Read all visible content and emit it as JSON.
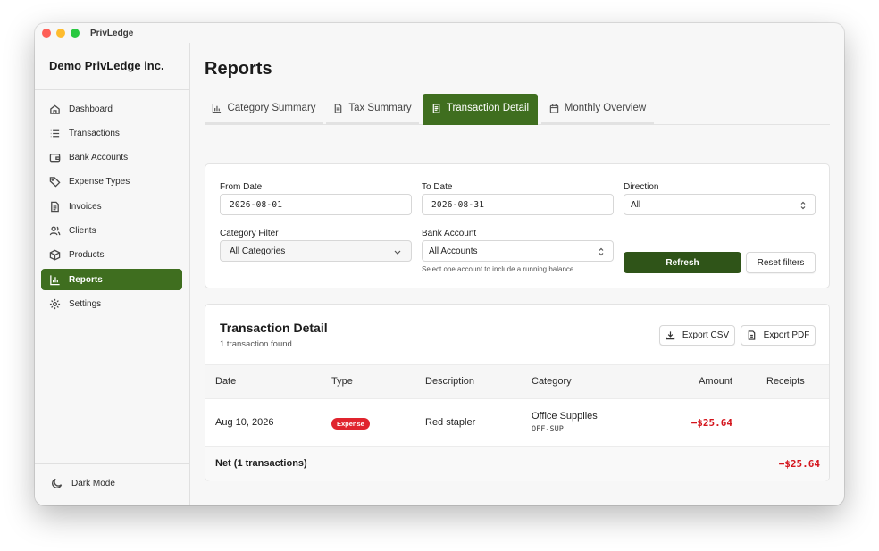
{
  "window": {
    "title": "PrivLedge"
  },
  "sidebar": {
    "company": "Demo PrivLedge inc.",
    "items": [
      {
        "label": "Dashboard",
        "icon": "home-icon"
      },
      {
        "label": "Transactions",
        "icon": "list-icon"
      },
      {
        "label": "Bank Accounts",
        "icon": "wallet-icon"
      },
      {
        "label": "Expense Types",
        "icon": "tag-icon"
      },
      {
        "label": "Invoices",
        "icon": "document-icon"
      },
      {
        "label": "Clients",
        "icon": "users-icon"
      },
      {
        "label": "Products",
        "icon": "box-icon"
      },
      {
        "label": "Reports",
        "icon": "bar-chart-icon",
        "active": true
      },
      {
        "label": "Settings",
        "icon": "gear-icon"
      }
    ],
    "dark_mode_label": "Dark Mode"
  },
  "page": {
    "title": "Reports",
    "tabs": [
      {
        "label": "Category Summary",
        "icon": "bar-chart-icon"
      },
      {
        "label": "Tax Summary",
        "icon": "document-icon"
      },
      {
        "label": "Transaction Detail",
        "icon": "document-icon",
        "active": true
      },
      {
        "label": "Monthly Overview",
        "icon": "calendar-icon"
      }
    ]
  },
  "filters": {
    "from_date_label": "From Date",
    "from_date_value": "2026-08-01",
    "to_date_label": "To Date",
    "to_date_value": "2026-08-31",
    "direction_label": "Direction",
    "direction_value": "All",
    "category_label": "Category Filter",
    "category_value": "All Categories",
    "bank_label": "Bank Account",
    "bank_value": "All Accounts",
    "bank_hint": "Select one account to include a running balance.",
    "refresh_label": "Refresh",
    "reset_label": "Reset filters"
  },
  "detail": {
    "title": "Transaction Detail",
    "subtitle": "1 transaction found",
    "export_csv_label": "Export CSV",
    "export_pdf_label": "Export PDF",
    "columns": [
      "Date",
      "Type",
      "Description",
      "Category",
      "Amount",
      "Receipts"
    ],
    "rows": [
      {
        "date": "Aug 10, 2026",
        "type": "Expense",
        "description": "Red stapler",
        "category": "Office Supplies",
        "category_code": "OFF-SUP",
        "amount": "−$25.64",
        "receipts": ""
      }
    ],
    "footer_label": "Net (1 transactions)",
    "footer_amount": "−$25.64"
  },
  "colors": {
    "accent": "#3f6e1f",
    "primary_button": "#2f5418",
    "expense_badge": "#e0242e",
    "negative_amount": "#d4141c"
  }
}
